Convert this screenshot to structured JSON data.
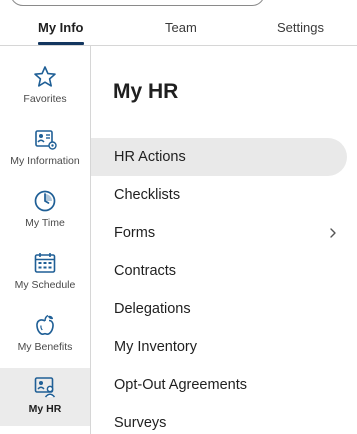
{
  "tabs": [
    {
      "label": "My Info",
      "active": true
    },
    {
      "label": "Team",
      "active": false
    },
    {
      "label": "Settings",
      "active": false
    }
  ],
  "sidebar": {
    "items": [
      {
        "label": "Favorites",
        "icon": "star-icon"
      },
      {
        "label": "My Information",
        "icon": "id-card-icon"
      },
      {
        "label": "My Time",
        "icon": "clock-icon"
      },
      {
        "label": "My Schedule",
        "icon": "calendar-icon"
      },
      {
        "label": "My Benefits",
        "icon": "apple-icon"
      },
      {
        "label": "My HR",
        "icon": "hr-person-icon",
        "active": true
      }
    ]
  },
  "main": {
    "title": "My HR",
    "items": [
      {
        "label": "HR Actions",
        "active": true
      },
      {
        "label": "Checklists"
      },
      {
        "label": "Forms",
        "has_submenu": true
      },
      {
        "label": "Contracts"
      },
      {
        "label": "Delegations"
      },
      {
        "label": "My Inventory"
      },
      {
        "label": "Opt-Out Agreements"
      },
      {
        "label": "Surveys"
      }
    ]
  },
  "colors": {
    "accent": "#13365f",
    "icon": "#1f5f96",
    "active_bg": "#e9e9e9"
  }
}
